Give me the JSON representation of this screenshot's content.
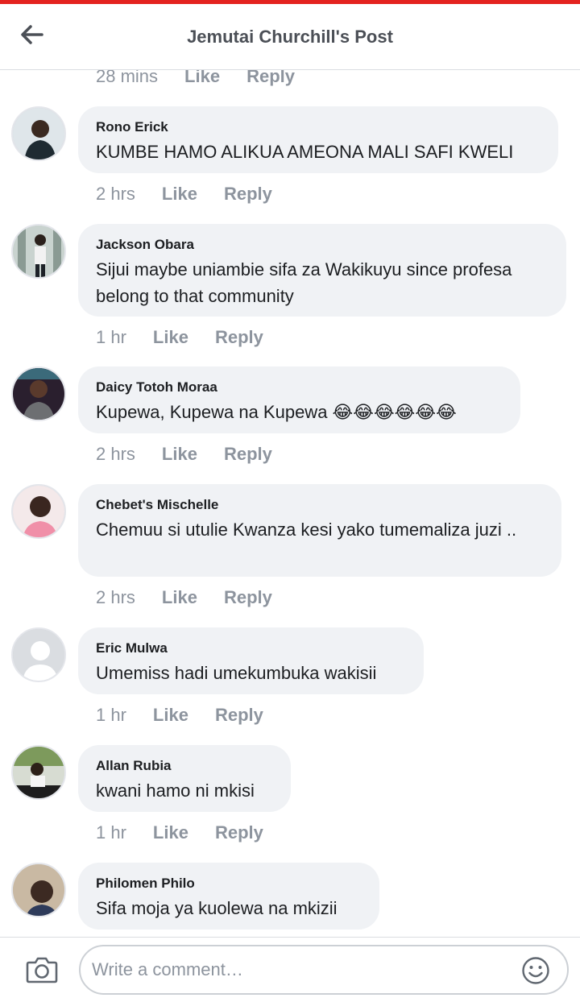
{
  "header": {
    "back_icon": "arrow-left-icon",
    "title": "Jemutai Churchill's Post"
  },
  "top_meta": {
    "time": "28 mins",
    "like": "Like",
    "reply": "Reply"
  },
  "comments": [
    {
      "author": "Rono Erick",
      "text": "KUMBE HAMO ALIKUA AMEONA MALI SAFI KWELI",
      "time": "2 hrs",
      "like": "Like",
      "reply": "Reply"
    },
    {
      "author": "Jackson Obara",
      "text": "Sijui maybe uniambie sifa za Wakikuyu since profesa belong to that community",
      "time": "1 hr",
      "like": "Like",
      "reply": "Reply"
    },
    {
      "author": "Daicy Totoh Moraa",
      "text": "Kupewa, Kupewa na Kupewa 😂😂😂😂😂😂",
      "time": "2 hrs",
      "like": "Like",
      "reply": "Reply"
    },
    {
      "author": "Chebet's Mischelle",
      "text": "Chemuu si utulie Kwanza  kesi yako tumemaliza juzi ..",
      "time": "2 hrs",
      "like": "Like",
      "reply": "Reply"
    },
    {
      "author": "Eric Mulwa",
      "text": "Umemiss hadi umekumbuka wakisii",
      "time": "1 hr",
      "like": "Like",
      "reply": "Reply"
    },
    {
      "author": "Allan Rubia",
      "text": "kwani hamo ni mkisi",
      "time": "1 hr",
      "like": "Like",
      "reply": "Reply"
    },
    {
      "author": "Philomen Philo",
      "text": "Sifa moja ya kuolewa na mkizii"
    }
  ],
  "composer": {
    "camera_icon": "camera-icon",
    "placeholder": "Write a comment…",
    "smiley_icon": "smiley-icon"
  },
  "colors": {
    "accent_bar": "#e4231f",
    "bubble": "#f0f2f5",
    "meta_text": "#8d949e",
    "header_title": "#4b4f56"
  }
}
